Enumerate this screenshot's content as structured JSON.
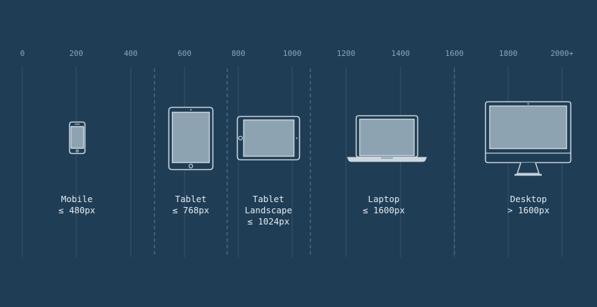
{
  "ticks": [
    "0",
    "200",
    "400",
    "600",
    "800",
    "1000",
    "1200",
    "1400",
    "1600",
    "1800",
    "2000+"
  ],
  "breakpoints": [
    {
      "lines": [
        "Mobile",
        "≤ 480px"
      ],
      "icon": "phone-icon"
    },
    {
      "lines": [
        "Tablet",
        "≤ 768px"
      ],
      "icon": "tablet-icon"
    },
    {
      "lines": [
        "Tablet",
        "Landscape",
        "≤ 1024px"
      ],
      "icon": "tablet-landscape-icon"
    },
    {
      "lines": [
        "Laptop",
        "≤ 1600px"
      ],
      "icon": "laptop-icon"
    },
    {
      "lines": [
        "Desktop",
        "> 1600px"
      ],
      "icon": "desktop-icon"
    }
  ],
  "colors": {
    "background": "#1f3d55",
    "device_outline": "#cbd6de",
    "device_screen": "#8ea3b2",
    "dashed_divider": "#4c7896"
  }
}
